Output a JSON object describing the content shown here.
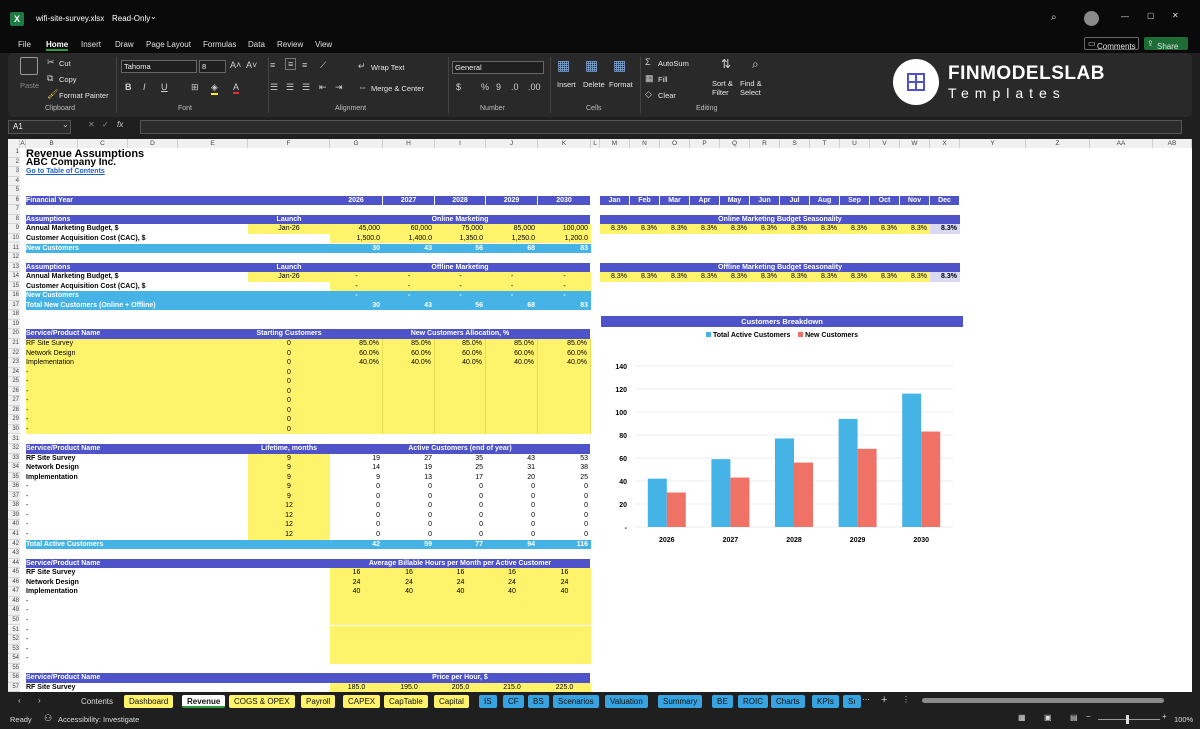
{
  "titlebar": {
    "filename": "wifi-site-survey.xlsx",
    "mode": "Read-Only"
  },
  "menu": [
    "File",
    "Home",
    "Insert",
    "Draw",
    "Page Layout",
    "Formulas",
    "Data",
    "Review",
    "View"
  ],
  "actions": {
    "comments": "Comments",
    "share": "Share"
  },
  "ribbon": {
    "paste": "Paste",
    "cut": "Cut",
    "copy": "Copy",
    "format_painter": "Format Painter",
    "clipboard": "Clipboard",
    "font_name": "Tahoma",
    "font_size": "8",
    "font": "Font",
    "wrap": "Wrap Text",
    "merge": "Merge & Center",
    "alignment": "Alignment",
    "numfmt": "General",
    "number": "Number",
    "insert": "Insert",
    "delete": "Delete",
    "format": "Format",
    "cells": "Cells",
    "autosum": "AutoSum",
    "fill": "Fill",
    "clear": "Clear",
    "sort": "Sort &\nFilter",
    "find": "Find &\nSelect",
    "editing": "Editing"
  },
  "brand": {
    "name": "FINMODELSLAB",
    "sub": "Templates"
  },
  "namebox": "A1",
  "columns": [
    "A",
    "B",
    "C",
    "D",
    "E",
    "F",
    "G",
    "H",
    "I",
    "J",
    "K",
    "L",
    "M",
    "N",
    "O",
    "P",
    "Q",
    "R",
    "S",
    "T",
    "U",
    "V",
    "W",
    "X",
    "Y",
    "Z",
    "AA",
    "AB"
  ],
  "sheet": {
    "title": "Revenue Assumptions",
    "company": "ABC Company Inc.",
    "toc": "Go to Table of Contents",
    "fy": "Financial Year",
    "years": [
      "2026",
      "2027",
      "2028",
      "2029",
      "2030"
    ],
    "months": [
      "Jan",
      "Feb",
      "Mar",
      "Apr",
      "May",
      "Jun",
      "Jul",
      "Aug",
      "Sep",
      "Oct",
      "Nov",
      "Dec"
    ],
    "assumptions": "Assumptions",
    "launch": "Launch",
    "online_mkt": "Online Marketing",
    "offline_mkt": "Offline Marketing",
    "budget_label": "Annual Marketing Budget, $",
    "cac_label": "Customer Acquisition Cost (CAC), $",
    "new_customers": "New Customers",
    "total_new": "Total New Customers (Online + Offline)",
    "online_launch": "Jan-26",
    "online_budget": [
      "45,000",
      "60,000",
      "75,000",
      "85,000",
      "100,000"
    ],
    "online_cac": [
      "1,500.0",
      "1,400.0",
      "1,350.0",
      "1,250.0",
      "1,200.0"
    ],
    "online_new": [
      "30",
      "43",
      "56",
      "68",
      "83"
    ],
    "offline_launch": "Jan-26",
    "dash": "-",
    "total_new_vals": [
      "30",
      "43",
      "56",
      "68",
      "83"
    ],
    "online_season_title": "Online Marketing Budget Seasonality",
    "offline_season_title": "Offline Marketing Budget Seasonality",
    "season_val": "8.3%",
    "svc_header": "Service/Product Name",
    "starting_customers": "Starting Customers",
    "alloc_title": "New Customers Allocation, %",
    "services": [
      "RF Site Survey",
      "Network Design",
      "Implementation"
    ],
    "start_vals": [
      "0",
      "0",
      "0",
      "0",
      "0",
      "0",
      "0",
      "0",
      "0",
      "0"
    ],
    "alloc": [
      [
        "85.0%",
        "85.0%",
        "85.0%",
        "85.0%",
        "85.0%"
      ],
      [
        "60.0%",
        "60.0%",
        "60.0%",
        "60.0%",
        "60.0%"
      ],
      [
        "40.0%",
        "40.0%",
        "40.0%",
        "40.0%",
        "40.0%"
      ]
    ],
    "lifetime": "Lifetime, months",
    "active_title": "Active Customers (end of year)",
    "lifetimes": [
      "9",
      "9",
      "9",
      "9",
      "9",
      "12",
      "12",
      "12",
      "12"
    ],
    "active": [
      [
        "19",
        "27",
        "35",
        "43",
        "53"
      ],
      [
        "14",
        "19",
        "25",
        "31",
        "38"
      ],
      [
        "9",
        "13",
        "17",
        "20",
        "25"
      ]
    ],
    "zero": "0",
    "total_active": "Total Active Customers",
    "total_active_vals": [
      "42",
      "59",
      "77",
      "94",
      "116"
    ],
    "hours_title": "Average Billable Hours per Month per Active Customer",
    "hours": [
      [
        "16",
        "16",
        "16",
        "16",
        "16"
      ],
      [
        "24",
        "24",
        "24",
        "24",
        "24"
      ],
      [
        "40",
        "40",
        "40",
        "40",
        "40"
      ]
    ],
    "price_title": "Price per Hour, $",
    "price_row": [
      "185.0",
      "195.0",
      "205.0",
      "215.0",
      "225.0"
    ]
  },
  "rows": [
    "1",
    "2",
    "3",
    "4",
    "5",
    "6",
    "7",
    "8",
    "9",
    "10",
    "11",
    "12",
    "13",
    "14",
    "15",
    "16",
    "17",
    "18",
    "19",
    "20",
    "21",
    "22",
    "23",
    "24",
    "25",
    "26",
    "27",
    "28",
    "29",
    "30",
    "31",
    "32",
    "33",
    "34",
    "35",
    "36",
    "37",
    "38",
    "39",
    "40",
    "41",
    "42",
    "43",
    "44",
    "45",
    "46",
    "47",
    "48",
    "49",
    "50",
    "51",
    "52",
    "53",
    "54",
    "55",
    "56",
    "57",
    "58"
  ],
  "chart_data": {
    "type": "bar",
    "title": "Customers Breakdown",
    "categories": [
      "2026",
      "2027",
      "2028",
      "2029",
      "2030"
    ],
    "series": [
      {
        "name": "Total Active Customers",
        "values": [
          42,
          59,
          77,
          94,
          116
        ],
        "color": "#45b3e6"
      },
      {
        "name": "New Customers",
        "values": [
          30,
          43,
          56,
          68,
          83
        ],
        "color": "#f07266"
      }
    ],
    "ylim": [
      0,
      140
    ],
    "yticks": [
      "-",
      "20",
      "40",
      "60",
      "80",
      "100",
      "120",
      "140"
    ],
    "legend": "top",
    "grid": true
  },
  "tabs": [
    "Contents",
    "Dashboard",
    "Revenue",
    "COGS & OPEX",
    "Payroll",
    "CAPEX",
    "CapTable",
    "Capital",
    "IS",
    "CF",
    "BS",
    "Scenarios",
    "Valuation",
    "Summary",
    "BE",
    "ROIC",
    "Charts",
    "KPIs",
    "Sı"
  ],
  "status": {
    "ready": "Ready",
    "access": "Accessibility: Investigate",
    "zoom": "100%"
  }
}
